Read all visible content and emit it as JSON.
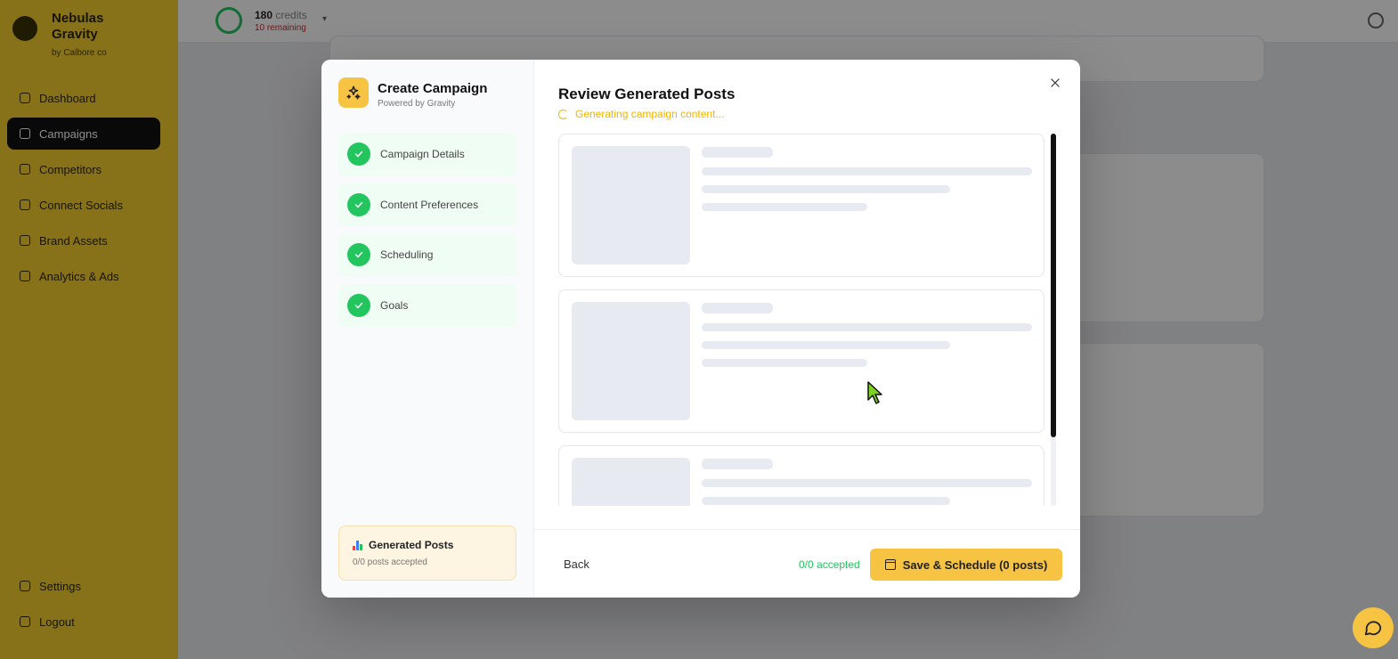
{
  "app": {
    "brand_name": "Nebulas Gravity",
    "brand_sub": "by Calbore co",
    "credits_value": "180",
    "credits_unit": "credits",
    "credits_sub": "10 remaining"
  },
  "sidebar": {
    "items": [
      {
        "label": "Dashboard"
      },
      {
        "label": "Campaigns"
      },
      {
        "label": "Competitors"
      },
      {
        "label": "Connect Socials"
      },
      {
        "label": "Brand Assets"
      },
      {
        "label": "Analytics & Ads"
      }
    ],
    "bottom": [
      {
        "label": "Settings"
      },
      {
        "label": "Logout"
      }
    ]
  },
  "modal": {
    "title": "Create Campaign",
    "subtitle": "Powered by Gravity",
    "steps": [
      {
        "label": "Campaign Details",
        "status": "complete"
      },
      {
        "label": "Content Preferences",
        "status": "complete"
      },
      {
        "label": "Scheduling",
        "status": "complete"
      },
      {
        "label": "Goals",
        "status": "complete"
      }
    ],
    "generated": {
      "title": "Generated Posts",
      "subtitle": "0/0 posts accepted"
    },
    "review_title": "Review Generated Posts",
    "status_text": "Generating campaign content...",
    "footer": {
      "back_label": "Back",
      "accepted_text": "0/0 accepted",
      "save_label": "Save & Schedule (0 posts)"
    }
  },
  "colors": {
    "accent": "#f6c343",
    "success": "#22c55e",
    "sidebar": "#f6cf2e"
  },
  "icons": {
    "modal_header": "sparkles-icon",
    "close": "close-icon",
    "step": "check-icon",
    "save": "calendar-icon",
    "chat": "chat-bubble-icon"
  }
}
